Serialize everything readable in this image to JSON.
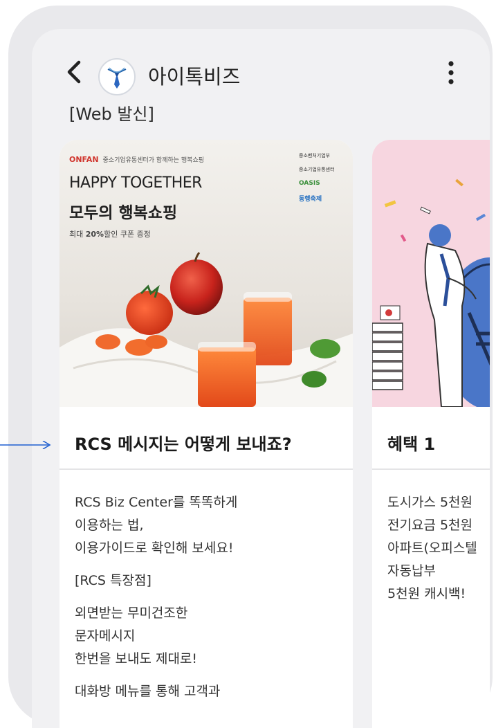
{
  "header": {
    "app_name": "아이톡비즈",
    "back_icon": "chevron-left-icon",
    "more_icon": "vertical-dots-icon",
    "avatar_icon": "tie-logo-icon"
  },
  "sender_tag": "[Web 발신]",
  "cards": [
    {
      "image": {
        "brand": "ONFAN",
        "top_small": "중소기업유통센터가 함께하는 행복쇼핑",
        "headline": "HAPPY TOGETHER",
        "subhead": "모두의 행복쇼핑",
        "discount_prefix": "최대 ",
        "discount_value": "20%",
        "discount_suffix": "할인 쿠폰 증정",
        "logos": [
          "중소벤처기업부",
          "중소기업유통센터",
          "OASIS",
          "동행축제"
        ]
      },
      "title": "RCS 메시지는 어떻게 보내죠?",
      "body": [
        "RCS Biz Center를 똑똑하게",
        "이용하는 법,",
        "이용가이드로 확인해 보세요!",
        "[RCS 특장점]",
        "외면받는 무미건조한",
        "문자메시지",
        "한번을 보내도 제대로!",
        "대화방 메뉴를 통해 고객과"
      ]
    },
    {
      "title": "혜택 1",
      "body": [
        "도시가스 5천원",
        "전기요금 5천원",
        "아파트(오피스텔",
        "자동납부",
        "5천원 캐시백!"
      ]
    }
  ],
  "colors": {
    "accent_blue": "#1f5fd0",
    "frame": "#e9e9ec",
    "screen_bg": "#f1f1f3",
    "card2_bg": "#f7d6e0"
  }
}
